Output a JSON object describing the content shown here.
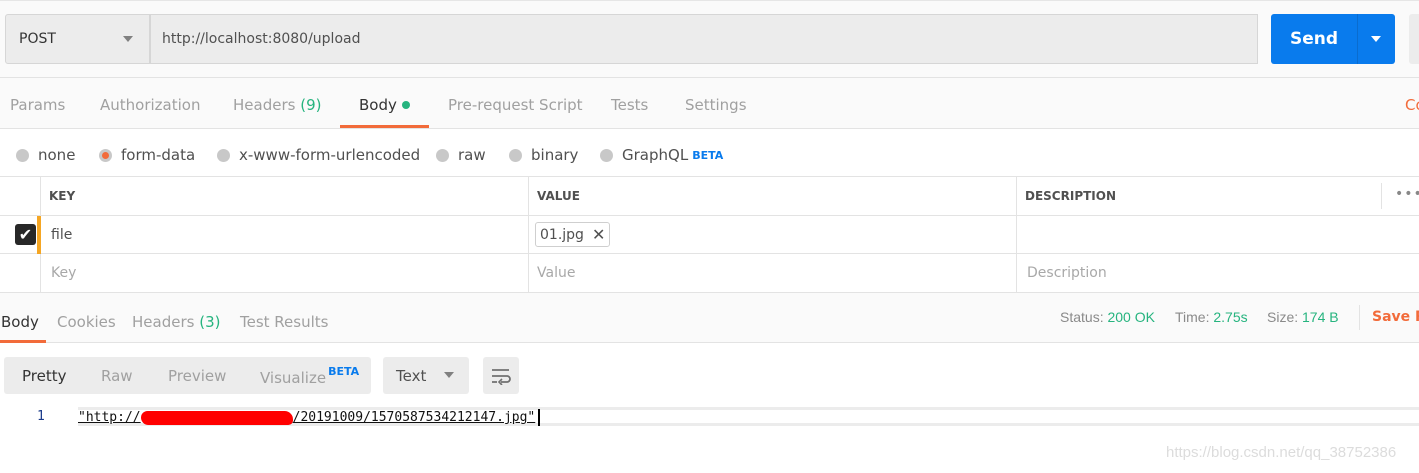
{
  "request": {
    "method": "POST",
    "url": "http://localhost:8080/upload",
    "send_label": "Send",
    "right_link": "Co"
  },
  "tabs": [
    {
      "label": "Params"
    },
    {
      "label": "Authorization"
    },
    {
      "label": "Headers",
      "count": "(9)"
    },
    {
      "label": "Body"
    },
    {
      "label": "Pre-request Script"
    },
    {
      "label": "Tests"
    },
    {
      "label": "Settings"
    }
  ],
  "body_types": [
    {
      "label": "none"
    },
    {
      "label": "form-data",
      "selected": true
    },
    {
      "label": "x-www-form-urlencoded"
    },
    {
      "label": "raw"
    },
    {
      "label": "binary"
    },
    {
      "label": "GraphQL",
      "badge": "BETA"
    }
  ],
  "table": {
    "headers": [
      "KEY",
      "VALUE",
      "DESCRIPTION"
    ],
    "rows": [
      {
        "checked": true,
        "key": "file",
        "value": "01.jpg"
      }
    ],
    "placeholders": {
      "key": "Key",
      "value": "Value",
      "description": "Description"
    }
  },
  "response": {
    "tabs": [
      {
        "label": "Body"
      },
      {
        "label": "Cookies"
      },
      {
        "label": "Headers",
        "count": "(3)"
      },
      {
        "label": "Test Results"
      }
    ],
    "status_label": "Status:",
    "status": "200 OK",
    "time_label": "Time:",
    "time": "2.75s",
    "size_label": "Size:",
    "size": "174 B",
    "save_label": "Save R",
    "views": [
      "Pretty",
      "Raw",
      "Preview",
      "Visualize"
    ],
    "visualize_badge": "BETA",
    "format": "Text",
    "line_number": "1",
    "code_prefix": "\"http://",
    "code_suffix": "/20191009/1570587534212147.jpg\""
  },
  "watermark": "https://blog.csdn.net/qq_38752386",
  "colors": {
    "accent": "#f26b3a",
    "send": "#097bed",
    "success": "#26b47f"
  }
}
